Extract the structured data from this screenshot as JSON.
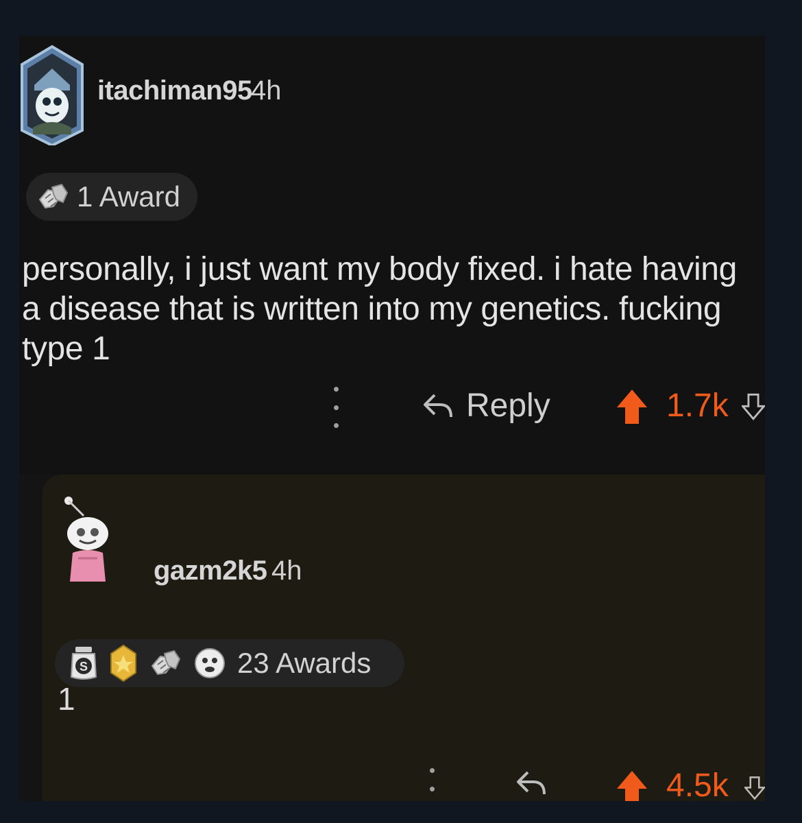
{
  "comment1": {
    "username": "itachiman95",
    "time": "4h",
    "awards_label": "1 Award",
    "body": "personally, i just want my body fixed. i hate having a disease that is written into my genetics. fucking type 1",
    "reply_label": "Reply",
    "score": "1.7k",
    "icons": {
      "avatar": "snoo-avatar",
      "award": "handshake-award-icon",
      "more": "more-vertical-icon",
      "reply": "reply-arrow-icon",
      "upvote": "upvote-arrow-icon",
      "downvote": "downvote-arrow-icon"
    }
  },
  "comment2": {
    "username": "gazm2k5",
    "time": "4h",
    "awards_label": "23 Awards",
    "body": "1",
    "score": "4.5k",
    "icons": {
      "avatar": "snoo-avatar",
      "awards": [
        "silver-award-icon",
        "gold-award-icon",
        "handshake-award-icon",
        "face-award-icon"
      ],
      "more": "more-vertical-icon",
      "reply": "reply-arrow-icon",
      "upvote": "upvote-arrow-icon",
      "downvote": "downvote-arrow-icon"
    }
  },
  "colors": {
    "upvoted": "#f05a1a",
    "background": "#121212",
    "reply_background": "#1e1c12",
    "page_background": "#101721"
  }
}
